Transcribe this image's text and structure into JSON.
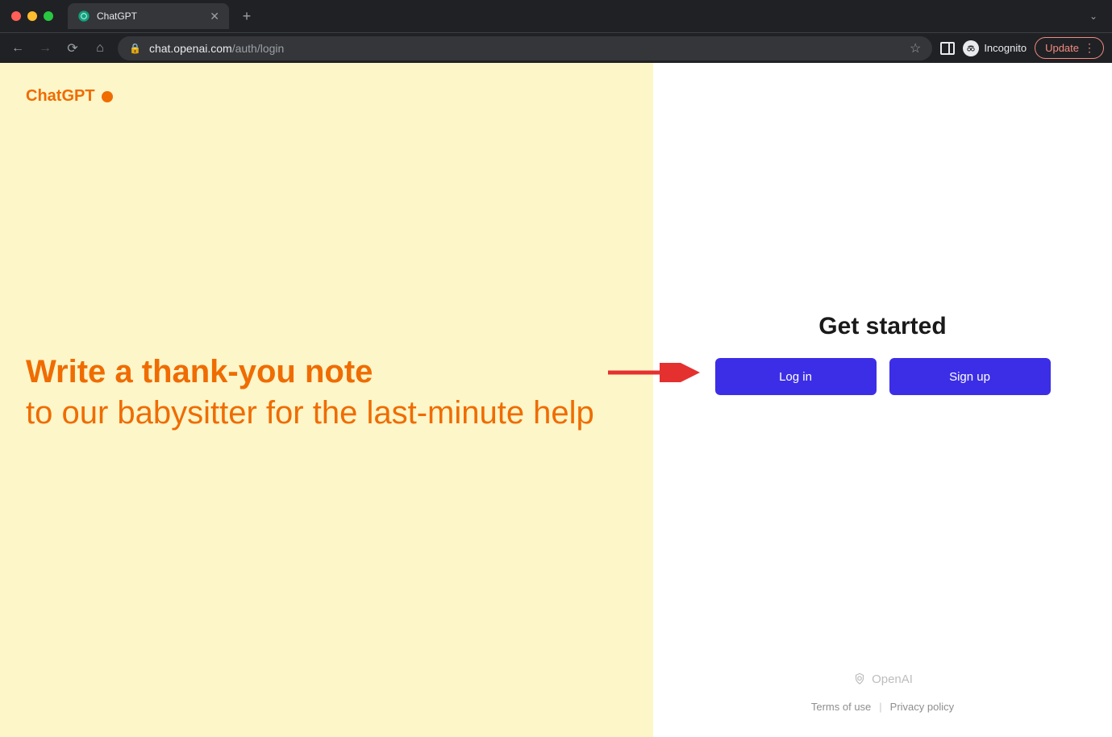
{
  "browser": {
    "tab_title": "ChatGPT",
    "url_host": "chat.openai.com",
    "url_path": "/auth/login",
    "incognito_label": "Incognito",
    "update_label": "Update"
  },
  "brand": {
    "name": "ChatGPT"
  },
  "prompt": {
    "line1": "Write a thank-you note",
    "line2": "to our babysitter for the last-minute help"
  },
  "auth": {
    "heading": "Get started",
    "login_label": "Log in",
    "signup_label": "Sign up"
  },
  "footer": {
    "company": "OpenAI",
    "terms_label": "Terms of use",
    "privacy_label": "Privacy policy"
  },
  "colors": {
    "accent_orange": "#ef6c00",
    "left_bg": "#fdf6c9",
    "button_blue": "#3c2ee6",
    "annotation_red": "#e53030"
  }
}
